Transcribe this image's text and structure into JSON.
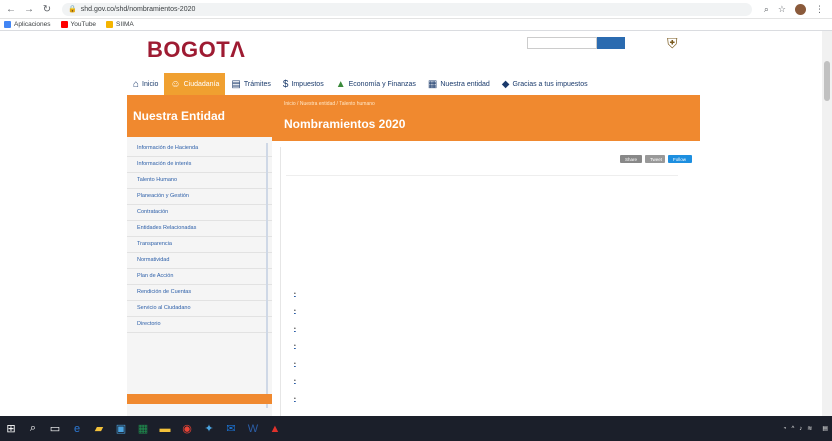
{
  "browser": {
    "url": "shd.gov.co/shd/nombramientos-2020",
    "bookmarks": [
      {
        "label": "Aplicaciones",
        "color": "#4285f4"
      },
      {
        "label": "YouTube",
        "color": "#ff0000"
      },
      {
        "label": "SIIMA",
        "color": "#f4b400"
      }
    ]
  },
  "site": {
    "logo": "BOGOTΛ",
    "nav": [
      {
        "label": "Inicio",
        "icon": "home-icon"
      },
      {
        "label": "Ciudadanía",
        "icon": "people-icon"
      },
      {
        "label": "Trámites",
        "icon": "document-icon"
      },
      {
        "label": "Impuestos",
        "icon": "money-icon"
      },
      {
        "label": "Economía y Finanzas",
        "icon": "chart-icon"
      },
      {
        "label": "Nuestra entidad",
        "icon": "building-icon"
      },
      {
        "label": "Gracias a tus impuestos",
        "icon": "bag-icon"
      }
    ]
  },
  "sidebar": {
    "title": "Nuestra Entidad",
    "items": [
      "Información de Hacienda",
      "Información de interés",
      "Talento Humano",
      "Planeación y Gestión",
      "Contratación",
      "Entidades Relacionadas",
      "Transparencia",
      "Normatividad",
      "Plan de Acción",
      "Rendición de Cuentas",
      "Servicio al Ciudadano",
      "Directorio"
    ]
  },
  "content": {
    "breadcrumb": "Inicio / Nuestra entidad / Talento humano",
    "title": "Nombramientos 2020",
    "share": [
      "Share",
      "Tweet",
      "Follow"
    ],
    "subheading": "",
    "paragraph": "",
    "paragraph2": "",
    "links": [
      "",
      "",
      "",
      "",
      "",
      "",
      ""
    ]
  },
  "taskbar": {
    "time": "",
    "date": ""
  }
}
